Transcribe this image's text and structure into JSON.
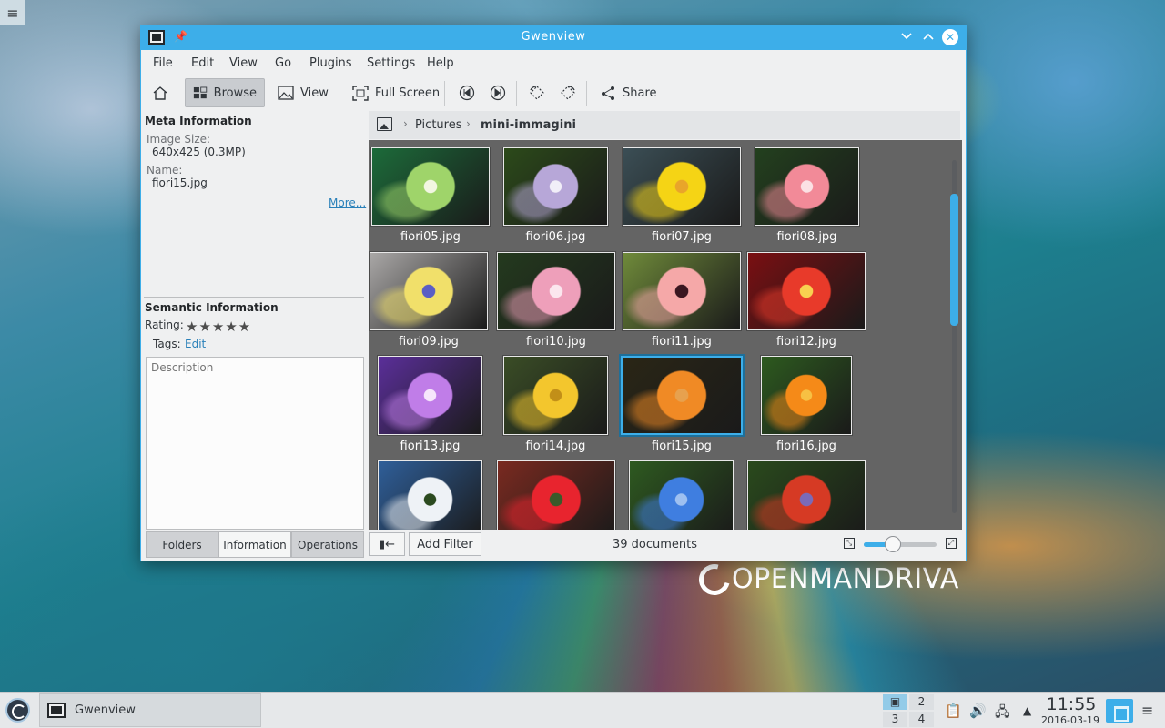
{
  "desktop": {
    "logo_text": "OPENMANDRIVA"
  },
  "window": {
    "title": "Gwenview"
  },
  "menu": [
    "File",
    "Edit",
    "View",
    "Go",
    "Plugins",
    "Settings",
    "Help"
  ],
  "toolbar": {
    "browse": "Browse",
    "view": "View",
    "fullscreen": "Full Screen",
    "share": "Share"
  },
  "meta": {
    "heading": "Meta Information",
    "image_size_label": "Image Size:",
    "image_size_value": "640x425 (0.3MP)",
    "name_label": "Name:",
    "name_value": "fiori15.jpg",
    "more_link": "More..."
  },
  "semantic": {
    "heading": "Semantic Information",
    "rating_label": "Rating:",
    "rating_stars": "★★★★★",
    "rating_value": 0,
    "tags_label": "Tags:",
    "tags_edit": "Edit",
    "description_placeholder": "Description"
  },
  "sidebar_tabs": [
    "Folders",
    "Information",
    "Operations"
  ],
  "sidebar_active_tab": "Information",
  "breadcrumb": [
    "Pictures",
    "mini-immagini"
  ],
  "thumbnails": [
    {
      "name": "fiori05.jpg",
      "colors": [
        "#1c6b3a",
        "#9fd46a",
        "#f2f6e2"
      ]
    },
    {
      "name": "fiori06.jpg",
      "colors": [
        "#2c4a1a",
        "#b7a7d8",
        "#f1eef8"
      ]
    },
    {
      "name": "fiori07.jpg",
      "colors": [
        "#3b4e55",
        "#f5d415",
        "#e9a52a"
      ]
    },
    {
      "name": "fiori08.jpg",
      "colors": [
        "#23401e",
        "#f28a98",
        "#fbe1e4"
      ]
    },
    {
      "name": "fiori09.jpg",
      "colors": [
        "#a9a7a6",
        "#f1e06a",
        "#5a5ec4"
      ]
    },
    {
      "name": "fiori10.jpg",
      "colors": [
        "#243a1e",
        "#ee9fba",
        "#fbe6ee"
      ]
    },
    {
      "name": "fiori11.jpg",
      "colors": [
        "#6f8a3a",
        "#f5a8a8",
        "#3a1620"
      ]
    },
    {
      "name": "fiori12.jpg",
      "colors": [
        "#7a0f12",
        "#e83a2a",
        "#f8d050"
      ]
    },
    {
      "name": "fiori13.jpg",
      "colors": [
        "#5b2f9a",
        "#c07de8",
        "#f6e6fb"
      ]
    },
    {
      "name": "fiori14.jpg",
      "colors": [
        "#3a4d26",
        "#f3c62d",
        "#c28f18"
      ]
    },
    {
      "name": "fiori15.jpg",
      "colors": [
        "#2a2616",
        "#f08a25",
        "#e7a14e"
      ]
    },
    {
      "name": "fiori16.jpg",
      "colors": [
        "#2d5a1f",
        "#f58a18",
        "#f7c043"
      ]
    },
    {
      "name": "",
      "colors": [
        "#2f5f9a",
        "#eef2f6",
        "#2b4a1f"
      ]
    },
    {
      "name": "",
      "colors": [
        "#7a2a20",
        "#e8242e",
        "#3a5a2a"
      ]
    },
    {
      "name": "",
      "colors": [
        "#2e5a20",
        "#3f7ee0",
        "#9ec0f0"
      ]
    },
    {
      "name": "",
      "colors": [
        "#2a4a1c",
        "#d63a24",
        "#7a6ab8"
      ]
    }
  ],
  "selected_thumbnail": "fiori15.jpg",
  "statusbar": {
    "toggle_label": "▮←",
    "add_filter": "Add Filter",
    "document_count": "39 documents",
    "zoom_level": 0.4
  },
  "taskbar": {
    "task_label": "Gwenview",
    "pager": [
      "1",
      "2",
      "3",
      "4"
    ],
    "active_desktop": "1",
    "time": "11:55",
    "date": "2016-03-19"
  },
  "colors": {
    "accent": "#3daee9",
    "window_bg": "#eff0f1",
    "thumb_bg": "#646464"
  }
}
